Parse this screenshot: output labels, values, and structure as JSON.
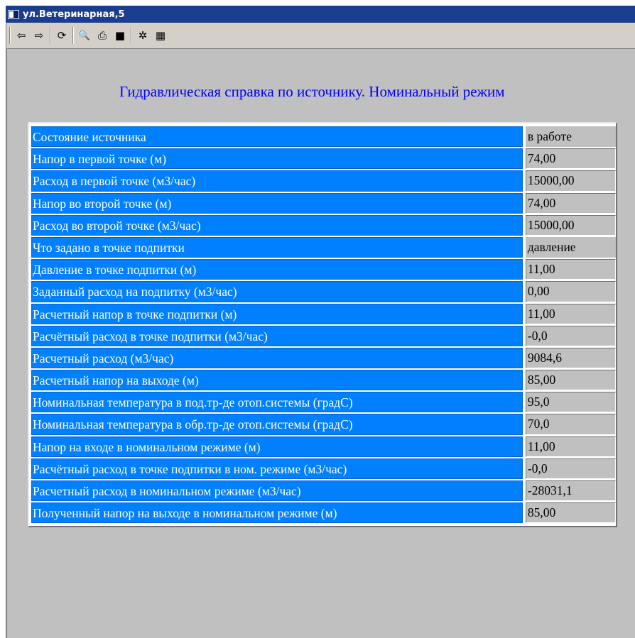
{
  "window": {
    "title": "ул.Ветеринарная,5"
  },
  "toolbar": {
    "buttons": [
      {
        "name": "back-button",
        "icon": "arrow-left-icon",
        "glyph": "⇦"
      },
      {
        "name": "forward-button",
        "icon": "arrow-right-icon",
        "glyph": "⇨"
      },
      {
        "name": "refresh-button",
        "icon": "refresh-icon",
        "glyph": "⟳"
      },
      {
        "name": "preview-button",
        "icon": "print-preview-icon",
        "glyph": "🔍"
      },
      {
        "name": "print-button",
        "icon": "printer-icon",
        "glyph": "⎙"
      },
      {
        "name": "save-button",
        "icon": "floppy-disk-icon",
        "glyph": "■"
      },
      {
        "name": "settings-button",
        "icon": "settings-icon",
        "glyph": "✲"
      },
      {
        "name": "table-settings-button",
        "icon": "table-icon",
        "glyph": "▦"
      }
    ]
  },
  "report": {
    "heading": "Гидравлическая справка по источнику. Номинальный режим",
    "rows": [
      {
        "label": "Состояние источника",
        "value": "в работе",
        "plain": true
      },
      {
        "label": "Напор в первой точке (м)",
        "value": "74,00"
      },
      {
        "label": "Расход в первой точке (м3/час)",
        "value": "15000,00"
      },
      {
        "label": "Напор во второй точке (м)",
        "value": "74,00"
      },
      {
        "label": "Расход во второй точке (м3/час)",
        "value": "15000,00"
      },
      {
        "label": "Что задано в точке подпитки",
        "value": "давление",
        "plain": true
      },
      {
        "label": "Давление в точке подпитки (м)",
        "value": "11,00"
      },
      {
        "label": "Заданный расход на подпитку (м3/час)",
        "value": "0,00"
      },
      {
        "label": "Расчетный напор в точке подпитки (м)",
        "value": "11,00"
      },
      {
        "label": "Расчётный расход в точке подпитки (м3/час)",
        "value": "-0,0"
      },
      {
        "label": "Расчетный расход (м3/час)",
        "value": "9084,6"
      },
      {
        "label": "Расчетный напор на выходе (м)",
        "value": "85,00"
      },
      {
        "label": "Номинальная температура в под.тр-де отоп.системы (градС)",
        "value": "95,0"
      },
      {
        "label": "Номинальная температура в обр.тр-де отоп.системы (градС)",
        "value": "70,0"
      },
      {
        "label": "Напор на входе в номинальном режиме (м)",
        "value": "11,00"
      },
      {
        "label": "Расчётный расход в точке подпитки в ном. режиме (м3/час)",
        "value": "-0,0"
      },
      {
        "label": "Расчетный расход в номинальном режиме (м3/час)",
        "value": "-28031,1"
      },
      {
        "label": "Полученный напор на выходе в номинальном режиме (м)",
        "value": "85,00"
      }
    ]
  },
  "colors": {
    "title_bar": "#1b3d8f",
    "label_cell": "#0080ff",
    "heading_text": "#0000ff",
    "window_bg": "#c0c0c0"
  }
}
